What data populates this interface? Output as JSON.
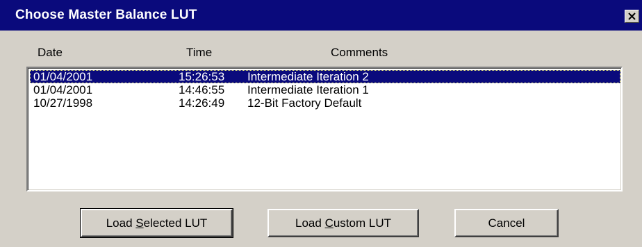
{
  "window": {
    "title": "Choose Master Balance LUT",
    "close_icon": "close-icon"
  },
  "columns": {
    "date": "Date",
    "time": "Time",
    "comments": "Comments"
  },
  "rows": [
    {
      "date": "01/04/2001",
      "time": "15:26:53",
      "comment": "Intermediate Iteration 2",
      "selected": true
    },
    {
      "date": "01/04/2001",
      "time": "14:46:55",
      "comment": "Intermediate Iteration 1",
      "selected": false
    },
    {
      "date": "10/27/1998",
      "time": "14:26:49",
      "comment": "12-Bit Factory Default",
      "selected": false
    }
  ],
  "buttons": {
    "load_selected": {
      "before": "Load ",
      "mnemonic": "S",
      "after": "elected LUT"
    },
    "load_custom": {
      "before": "Load ",
      "mnemonic": "C",
      "after": "ustom LUT"
    },
    "cancel": "Cancel"
  },
  "colors": {
    "titlebar": "#0a0a7c",
    "face": "#d4d0c8",
    "selection": "#0a0a7c"
  }
}
